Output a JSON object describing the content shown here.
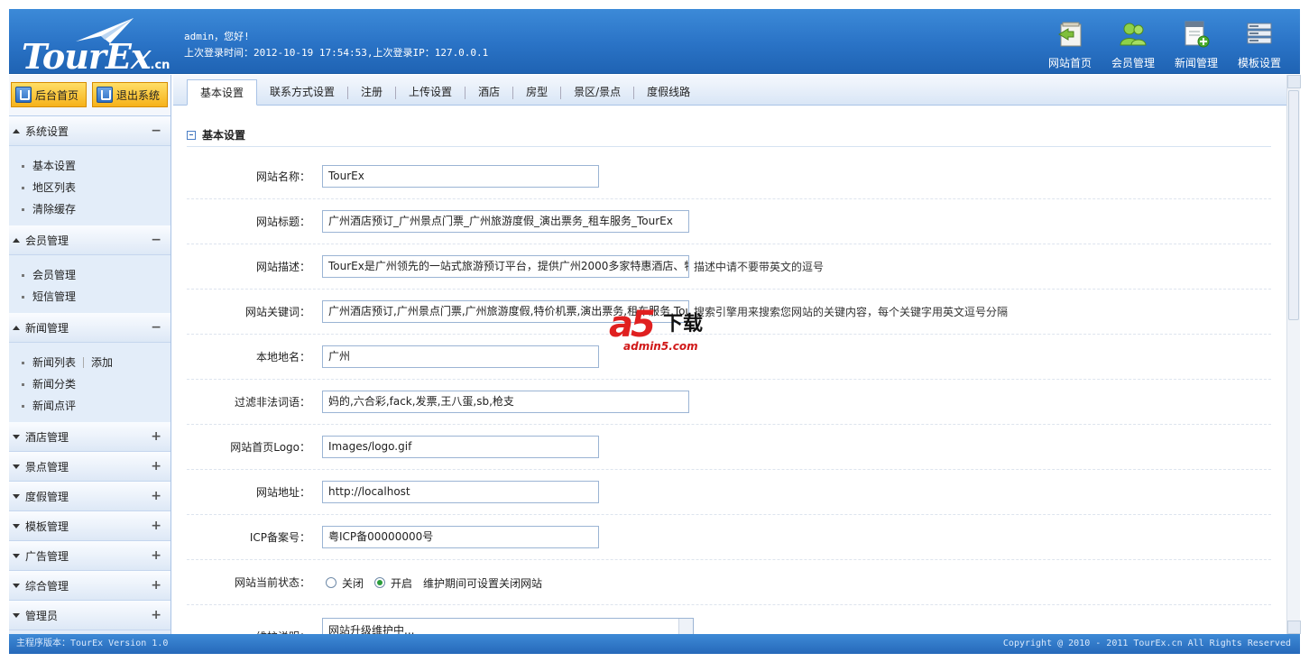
{
  "header": {
    "logo_text": "TourEx",
    "logo_suffix": ".cn",
    "welcome_line": "admin，您好!",
    "last_login_line": "上次登录时间：2012-10-19 17:54:53,上次登录IP：127.0.0.1",
    "nav": [
      {
        "label": "网站首页",
        "icon": "home-page-icon"
      },
      {
        "label": "会员管理",
        "icon": "members-icon"
      },
      {
        "label": "新闻管理",
        "icon": "add-news-icon"
      },
      {
        "label": "模板设置",
        "icon": "template-icon"
      }
    ]
  },
  "sidebar": {
    "buttons": [
      {
        "label": "后台首页"
      },
      {
        "label": "退出系统"
      }
    ],
    "groups": [
      {
        "title": "系统设置",
        "expanded": true,
        "items": [
          "基本设置",
          "地区列表",
          "清除缓存"
        ]
      },
      {
        "title": "会员管理",
        "expanded": true,
        "items": [
          "会员管理",
          "短信管理"
        ]
      },
      {
        "title": "新闻管理",
        "expanded": true,
        "items": [
          "新闻列表",
          "新闻分类",
          "新闻点评"
        ],
        "extra_link": "添加"
      },
      {
        "title": "酒店管理",
        "expanded": false
      },
      {
        "title": "景点管理",
        "expanded": false
      },
      {
        "title": "度假管理",
        "expanded": false
      },
      {
        "title": "模板管理",
        "expanded": false
      },
      {
        "title": "广告管理",
        "expanded": false
      },
      {
        "title": "综合管理",
        "expanded": false
      },
      {
        "title": "管理员",
        "expanded": false
      }
    ],
    "collapse_symbol": "−",
    "expand_symbol": "+"
  },
  "tabs": [
    "基本设置",
    "联系方式设置",
    "注册",
    "上传设置",
    "酒店",
    "房型",
    "景区/景点",
    "度假线路"
  ],
  "active_tab": 0,
  "section_title": "基本设置",
  "form": {
    "site_name": {
      "label": "网站名称：",
      "value": "TourEx"
    },
    "site_title": {
      "label": "网站标题：",
      "value": "广州酒店预订_广州景点门票_广州旅游度假_演出票务_租车服务_TourEx"
    },
    "site_desc": {
      "label": "网站描述：",
      "value": "TourEx是广州领先的一站式旅游预订平台，提供广州2000多家特惠酒店、特",
      "hint": "描述中请不要带英文的逗号"
    },
    "site_keywords": {
      "label": "网站关键词：",
      "value": "广州酒店预订,广州景点门票,广州旅游度假,特价机票,演出票务,租车服务,Tou",
      "hint": "搜索引擎用来搜索您网站的关键内容，每个关键字用英文逗号分隔"
    },
    "local_name": {
      "label": "本地地名：",
      "value": "广州"
    },
    "filter_words": {
      "label": "过滤非法词语：",
      "value": "妈的,六合彩,fack,发票,王八蛋,sb,枪支"
    },
    "home_logo": {
      "label": "网站首页Logo：",
      "value": "Images/logo.gif"
    },
    "site_url": {
      "label": "网站地址：",
      "value": "http://localhost"
    },
    "icp": {
      "label": "ICP备案号：",
      "value": "粤ICP备00000000号"
    },
    "status": {
      "label": "网站当前状态：",
      "options": [
        "关闭",
        "开启"
      ],
      "selected": "开启",
      "hint": "维护期间可设置关闭网站"
    },
    "maintenance": {
      "label": "维护说明：",
      "value": "网站升级维护中..."
    }
  },
  "watermark": {
    "brand": "a5",
    "download": "下载",
    "site": "admin5.com"
  },
  "footer": {
    "version": "主程序版本：TourEx Version 1.0",
    "copyright": "Copyright @ 2010 - 2011 TourEx.cn All Rights Reserved"
  },
  "colors": {
    "header_blue": "#2a73c6",
    "button_orange": "#f6b21a",
    "sidebar_bg": "#e3edf9"
  }
}
